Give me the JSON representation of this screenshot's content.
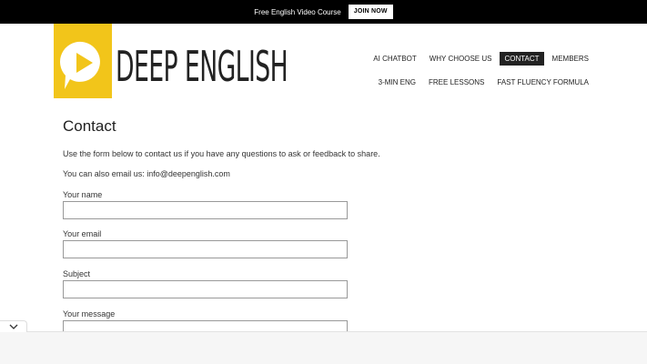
{
  "announcement": {
    "text": "Free English Video Course",
    "button_label": "JOIN NOW"
  },
  "brand": {
    "name": "DEEP ENGLISH",
    "color": "#f2c51a"
  },
  "nav": {
    "row1": [
      {
        "label": "AI CHATBOT",
        "active": false
      },
      {
        "label": "WHY CHOOSE US",
        "active": false
      },
      {
        "label": "CONTACT",
        "active": true
      },
      {
        "label": "MEMBERS",
        "active": false
      }
    ],
    "row2": [
      {
        "label": "3-MIN ENG",
        "active": false
      },
      {
        "label": "FREE LESSONS",
        "active": false
      },
      {
        "label": "FAST FLUENCY FORMULA",
        "active": false
      }
    ]
  },
  "page": {
    "title": "Contact",
    "intro": "Use the form below to contact us if you have any questions to ask or feedback to share.",
    "email_line": "You can also email us: info@deepenglish.com"
  },
  "form": {
    "name_label": "Your name",
    "name_value": "",
    "email_label": "Your email",
    "email_value": "",
    "subject_label": "Subject",
    "subject_value": "",
    "message_label": "Your message",
    "message_value": ""
  },
  "icons": {
    "play": "play-icon",
    "collapse": "chevron-down-icon"
  }
}
